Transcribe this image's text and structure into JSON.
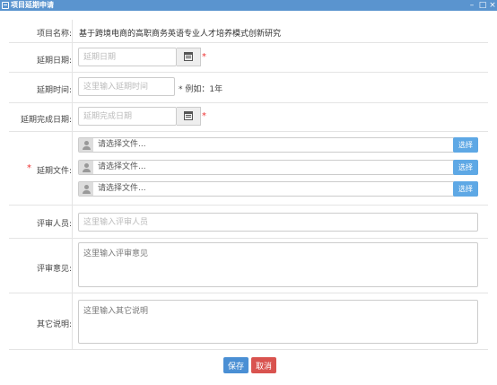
{
  "window": {
    "title": "项目延期申请",
    "minimize_glyph": "–",
    "maximize_glyph": "□",
    "close_glyph": "×"
  },
  "form": {
    "project_name": {
      "label": "项目名称:",
      "value": "基于跨境电商的高职商务英语专业人才培养模式创新研究"
    },
    "delay_date": {
      "label": "延期日期:",
      "placeholder": "延期日期",
      "icon": "calendar-icon"
    },
    "delay_time": {
      "label": "延期时间:",
      "placeholder": "这里输入延期时间",
      "hint": "* 例如：1年"
    },
    "delay_finish_date": {
      "label": "延期完成日期:",
      "placeholder": "延期完成日期",
      "icon": "calendar-icon"
    },
    "delay_files": {
      "label": "延期文件:",
      "required_mark": "*",
      "files": [
        {
          "text": "请选择文件...",
          "button": "选择"
        },
        {
          "text": "请选择文件...",
          "button": "选择"
        },
        {
          "text": "请选择文件...",
          "button": "选择"
        }
      ]
    },
    "reviewer": {
      "label": "评审人员:",
      "placeholder": "这里输入评审人员"
    },
    "review_opinion": {
      "label": "评审意见:",
      "placeholder": "这里输入评审意见"
    },
    "other_notes": {
      "label": "其它说明:",
      "placeholder": "这里输入其它说明"
    },
    "required_mark": "*"
  },
  "actions": {
    "save": "保存",
    "cancel": "取消"
  },
  "colors": {
    "titlebar": "#5a94cf",
    "save": "#4a8fd4",
    "cancel": "#d9534f",
    "choose": "#5ea8e5",
    "required": "#e33333"
  }
}
